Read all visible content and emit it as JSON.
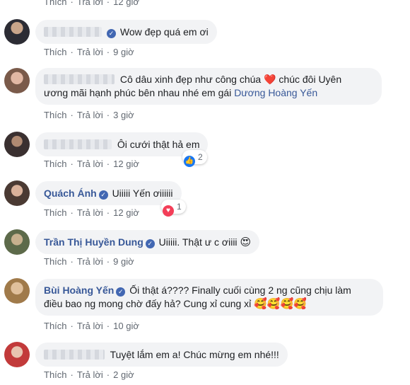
{
  "actions": {
    "like": "Thích",
    "reply": "Trả lời",
    "dot": "·"
  },
  "top_partial": {
    "time": "12 giờ"
  },
  "comments": [
    {
      "name": "",
      "verified": true,
      "text": "Wow đẹp quá em ơi",
      "time": "9 giờ"
    },
    {
      "name": "",
      "text_line1": "Cô dâu xinh đẹp như công chúa",
      "heart": "❤️",
      "text_line1b": "chúc đôi Uyên",
      "text_line2": "ương mãi hạnh phúc bên nhau nhé em gái",
      "tag": "Dương Hoàng Yến",
      "time": "3 giờ"
    },
    {
      "name": "",
      "text": "Ôi cưới thật hả em",
      "time": "12 giờ",
      "reaction": {
        "icon": "like-icon",
        "count": "2"
      }
    },
    {
      "name": "Quách Ánh",
      "verified": true,
      "text": "Uiiiii Yến ơiiiiii",
      "time": "12 giờ",
      "reaction": {
        "icon": "love-icon",
        "count": "1"
      }
    },
    {
      "name": "Trần Thị Huyền Dung",
      "verified": true,
      "text": "Uiiiii. Thật ư c ơiiii",
      "emoji": "😍",
      "time": "9 giờ"
    },
    {
      "name": "Bùi Hoàng Yến",
      "verified": true,
      "text_line1": "Ối thật á???? Finally cuối cùng 2 ng cũng chịu làm",
      "text_line2": "điều bao ng mong chờ đấy hả? Cung xỉ cung xỉ",
      "emoji": "🥰🥰🥰🥰",
      "time": "10 giờ"
    },
    {
      "name": "",
      "text": "Tuyệt lắm em a! Chúc mừng em nhé!!!",
      "time": "2 giờ"
    }
  ],
  "colors": {
    "link": "#385898",
    "bubble": "#f2f3f5",
    "meta": "#606770",
    "verified": "#4267b2"
  }
}
